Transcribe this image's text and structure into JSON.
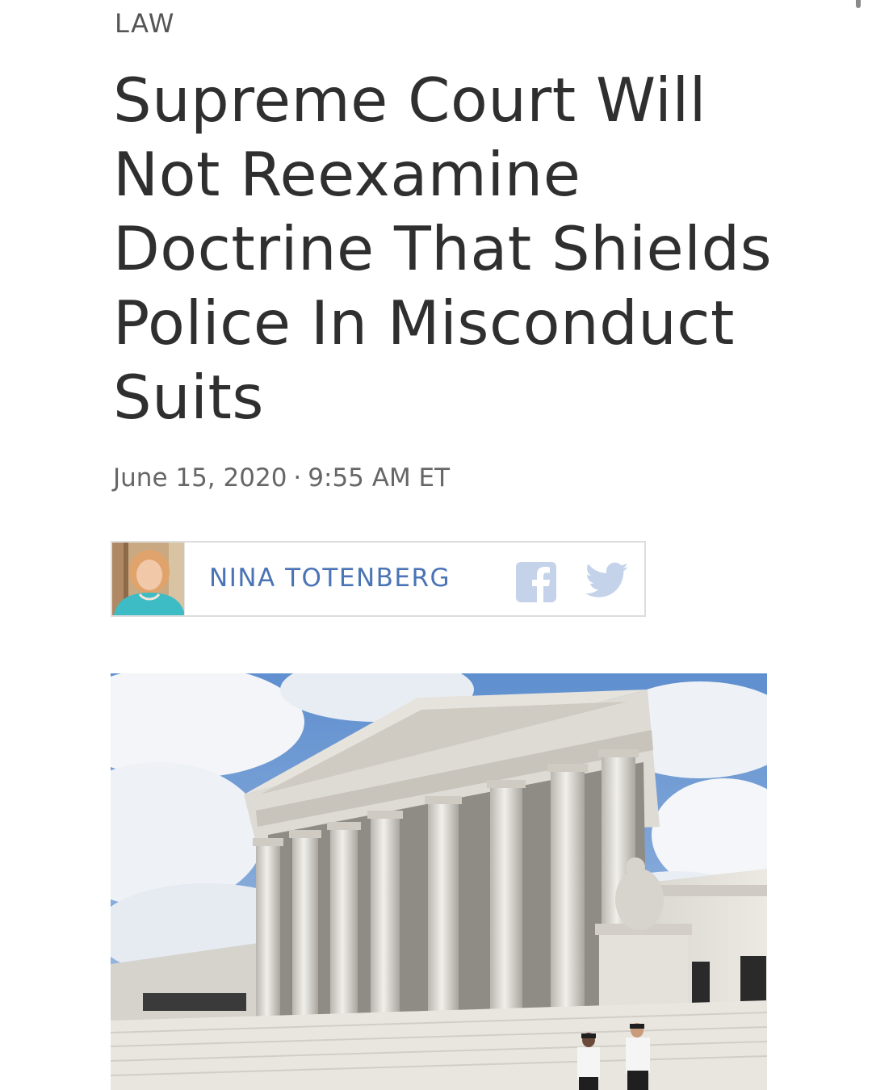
{
  "article": {
    "section": "LAW",
    "headline": "Supreme Court Will Not Reexamine Doctrine That Shields Police In Misconduct Suits",
    "date": "June 15, 2020",
    "separator": "·",
    "time": "9:55 AM ET"
  },
  "byline": {
    "author_name": "NINA TOTENBERG",
    "author_photo_alt": "Nina Totenberg",
    "share": {
      "facebook_icon": "facebook-icon",
      "twitter_icon": "twitter-icon"
    }
  },
  "lead_image": {
    "alt": "Supreme Court building"
  },
  "colors": {
    "text": "#2f2f2f",
    "muted": "#666666",
    "author_link": "#4a74b6",
    "share_icon": "#c5d3ea",
    "border": "#dddddd"
  }
}
